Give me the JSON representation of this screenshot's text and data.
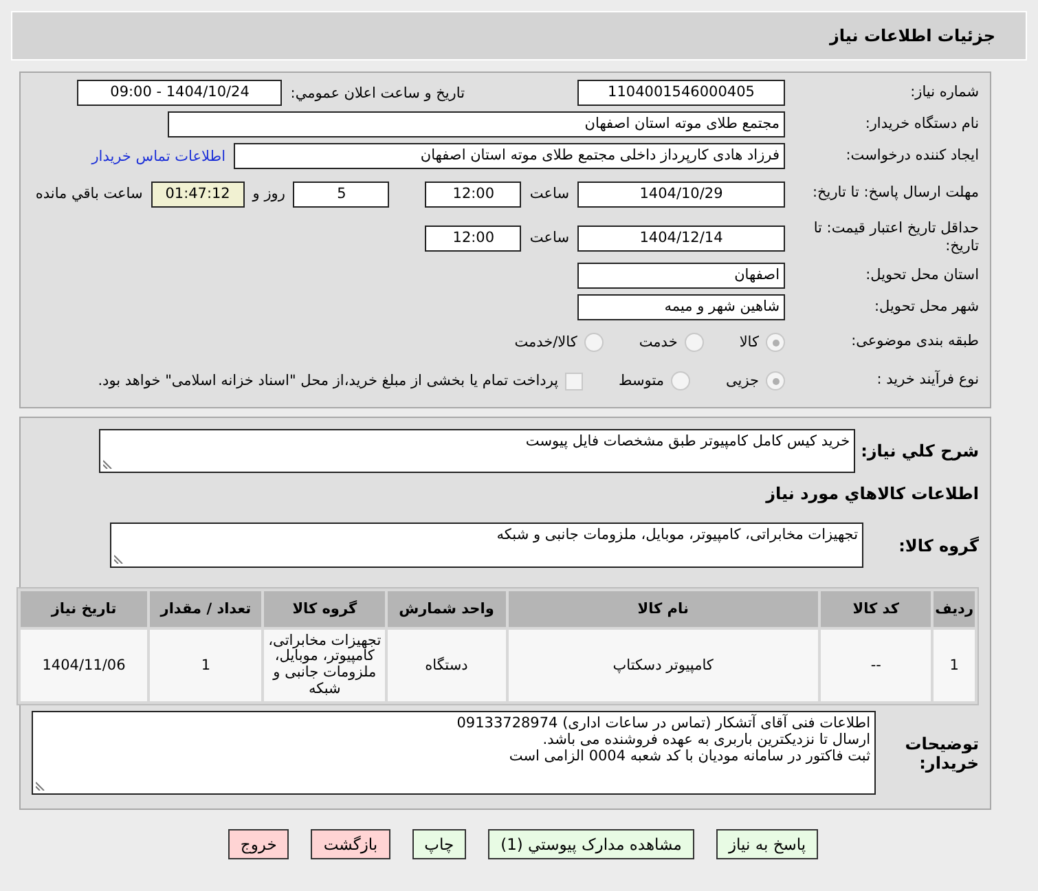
{
  "header": {
    "title": "جزئیات اطلاعات نیاز"
  },
  "need_number": {
    "label": "شماره نیاز:",
    "value": "1104001546000405"
  },
  "announce": {
    "label": "تاریخ و ساعت اعلان عمومي:",
    "value": "1404/10/24 - 09:00"
  },
  "buyer_org": {
    "label": "نام دستگاه خریدار:",
    "value": "مجتمع طلای موته استان اصفهان"
  },
  "requester": {
    "label": "ایجاد کننده درخواست:",
    "value": "فرزاد هادی کارپرداز داخلی مجتمع طلای موته استان اصفهان",
    "contact_link": "اطلاعات تماس خریدار"
  },
  "reply_deadline": {
    "label": "مهلت ارسال پاسخ: تا تاریخ:",
    "date": "1404/10/29",
    "time_label": "ساعت",
    "time": "12:00",
    "days": "5",
    "days_label": "روز و",
    "remaining": "01:47:12",
    "remaining_label": "ساعت باقي مانده"
  },
  "price_validity": {
    "label": "حداقل تاریخ اعتبار قیمت: تا تاریخ:",
    "date": "1404/12/14",
    "time_label": "ساعت",
    "time": "12:00"
  },
  "province": {
    "label": "استان محل تحویل:",
    "value": "اصفهان"
  },
  "city": {
    "label": "شهر محل تحویل:",
    "value": "شاهین شهر و میمه"
  },
  "category": {
    "label": "طبقه بندی موضوعی:",
    "options": [
      {
        "label": "کالا",
        "selected": true
      },
      {
        "label": "خدمت",
        "selected": false
      },
      {
        "label": "کالا/خدمت",
        "selected": false
      }
    ]
  },
  "purchase_type": {
    "label": "نوع فرآیند خرید :",
    "options": [
      {
        "label": "جزیی",
        "selected": true
      },
      {
        "label": "متوسط",
        "selected": false
      }
    ],
    "treasury": {
      "label": "پرداخت تمام یا بخشی از مبلغ خرید،از محل \"اسناد خزانه اسلامی\" خواهد بود.",
      "checked": false
    }
  },
  "description": {
    "label": "شرح کلي نیاز:",
    "value": "خرید کیس کامل کامپیوتر طبق مشخصات فایل پیوست"
  },
  "items_heading": "اطلاعات کالاهاي مورد نیاز",
  "goods_group": {
    "label": "گروه کالا:",
    "value": "تجهیزات مخابراتی، کامپیوتر، موبایل، ملزومات جانبی و شبکه"
  },
  "table": {
    "columns": [
      "ردیف",
      "کد کالا",
      "نام کالا",
      "واحد شمارش",
      "گروه کالا",
      "تعداد / مقدار",
      "تاریخ نیاز"
    ],
    "rows": [
      [
        "1",
        "--",
        "کامپیوتر دسکتاپ",
        "دستگاه",
        "تجهیزات مخابراتی، کامپیوتر، موبایل، ملزومات جانبی و شبکه",
        "1",
        "1404/11/06"
      ]
    ]
  },
  "buyer_notes": {
    "label": "توضیحات خریدار:",
    "lines": [
      "اطلاعات فنی آقای آتشکار (تماس در ساعات اداری) 09133728974",
      "ارسال تا نزدیکترین باربری به عهده فروشنده می باشد.",
      "ثبت فاکتور در سامانه مودیان با کد شعبه 0004 الزامی است"
    ]
  },
  "buttons": [
    {
      "label": "پاسخ به نیاز",
      "kind": "primary"
    },
    {
      "label": "مشاهده مدارک پیوستي (1)",
      "kind": "primary"
    },
    {
      "label": "چاپ",
      "kind": "primary"
    },
    {
      "label": "بازگشت",
      "kind": "danger"
    },
    {
      "label": "خروج",
      "kind": "danger"
    }
  ]
}
